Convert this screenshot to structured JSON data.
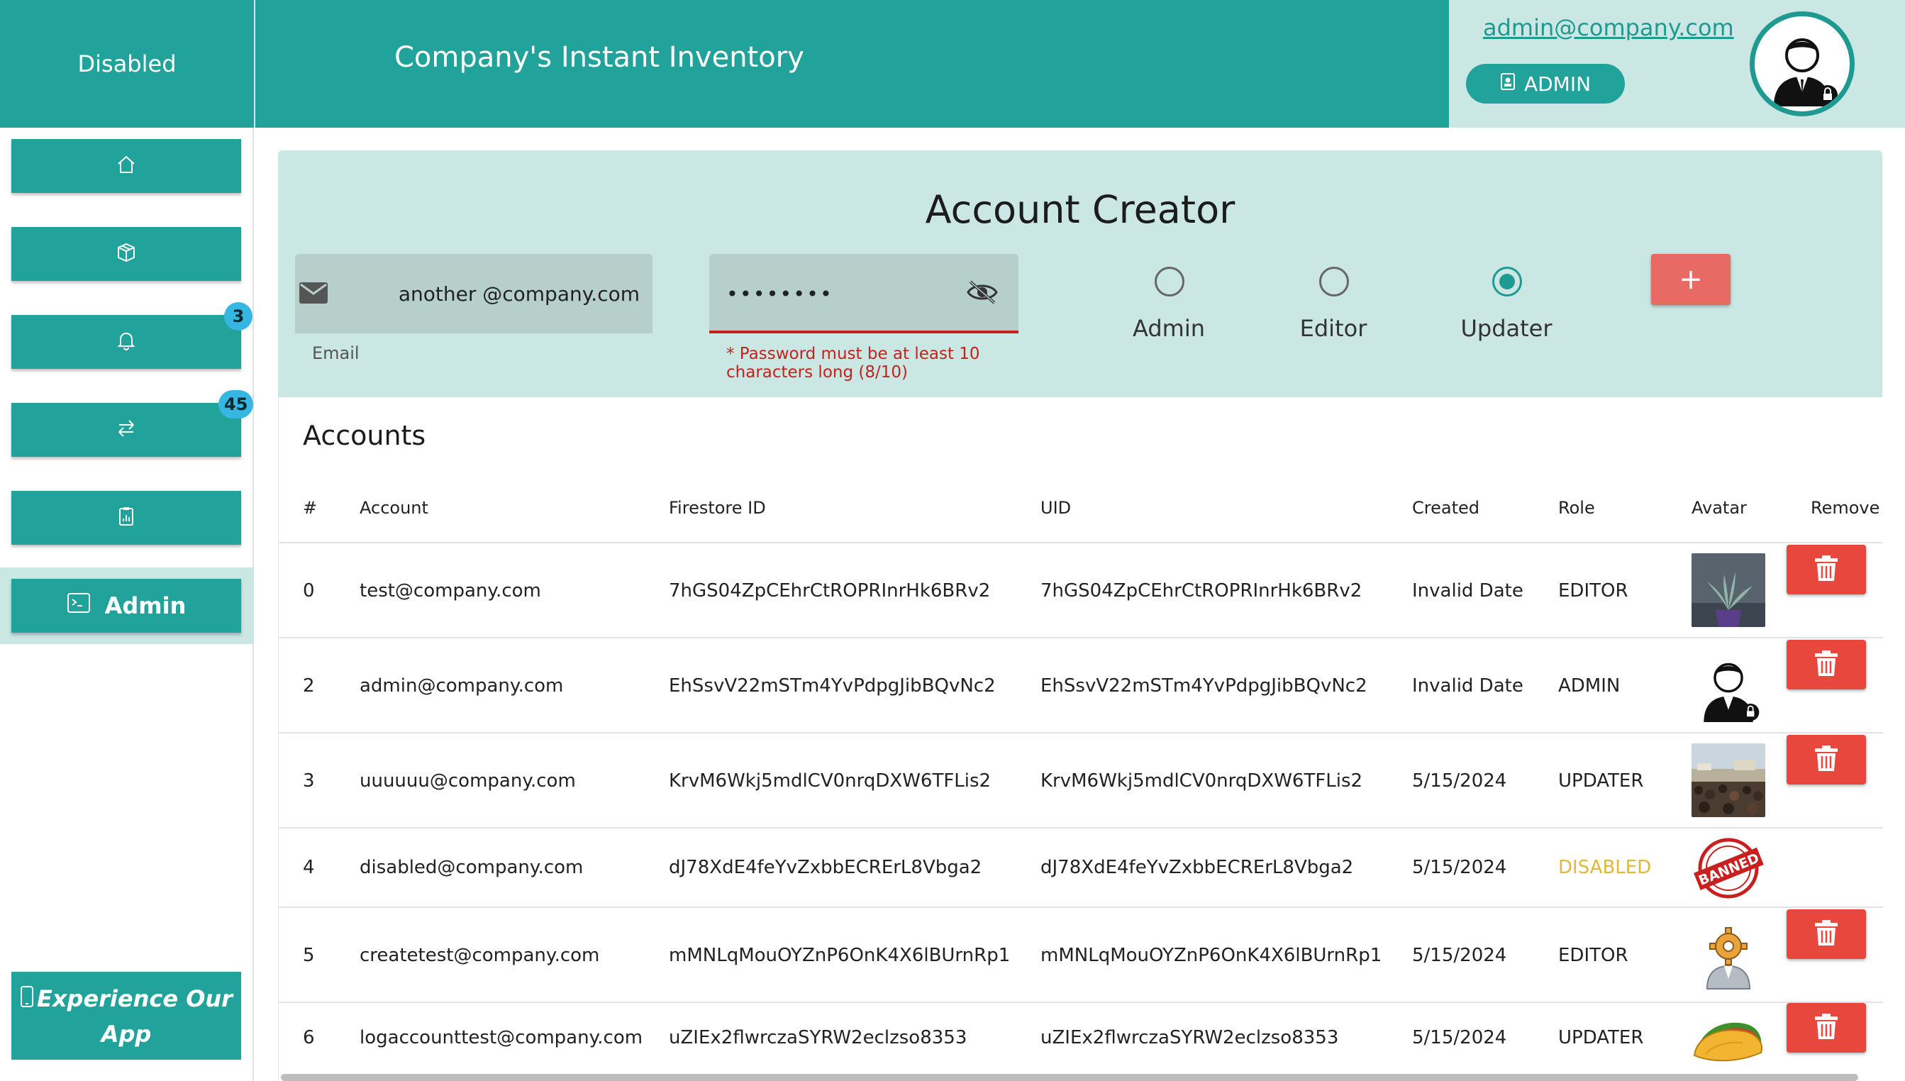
{
  "header": {
    "status": "Disabled",
    "title": "Company's Instant Inventory",
    "user_email": "admin@company.com",
    "role_badge": "ADMIN"
  },
  "sidebar": {
    "items": [
      {
        "icon": "home-icon"
      },
      {
        "icon": "box-icon"
      },
      {
        "icon": "bell-icon",
        "badge": "3"
      },
      {
        "icon": "transfer-icon",
        "badge": "45"
      },
      {
        "icon": "report-icon"
      }
    ],
    "admin_label": "Admin",
    "app_button_line1": "Experience Our",
    "app_button_line2": "App"
  },
  "creator": {
    "title": "Account Creator",
    "email_value": "another @company.com",
    "email_label": "Email",
    "password_value": "••••••••",
    "password_error": "* Password must be at least 10 characters long (8/10)",
    "roles": [
      "Admin",
      "Editor",
      "Updater"
    ],
    "selected_role": "Updater",
    "add_label": "+"
  },
  "accounts": {
    "title": "Accounts",
    "columns": [
      "#",
      "Account",
      "Firestore ID",
      "UID",
      "Created",
      "Role",
      "Avatar",
      "Remove"
    ],
    "rows": [
      {
        "num": "0",
        "account": "test@company.com",
        "firestore_id": "7hGS04ZpCEhrCtROPRInrHk6BRv2",
        "uid": "7hGS04ZpCEhrCtROPRInrHk6BRv2",
        "created": "Invalid Date",
        "role": "EDITOR",
        "avatar": "plant-photo"
      },
      {
        "num": "2",
        "account": "admin@company.com",
        "firestore_id": "EhSsvV22mSTm4YvPdpgJibBQvNc2",
        "uid": "EhSsvV22mSTm4YvPdpgJibBQvNc2",
        "created": "Invalid Date",
        "role": "ADMIN",
        "avatar": "admin-user-icon"
      },
      {
        "num": "3",
        "account": "uuuuuu@company.com",
        "firestore_id": "KrvM6Wkj5mdlCV0nrqDXW6TFLis2",
        "uid": "KrvM6Wkj5mdlCV0nrqDXW6TFLis2",
        "created": "5/15/2024",
        "role": "UPDATER",
        "avatar": "crowd-photo"
      },
      {
        "num": "4",
        "account": "disabled@company.com",
        "firestore_id": "dJ78XdE4feYvZxbbECRErL8Vbga2",
        "uid": "dJ78XdE4feYvZxbbECRErL8Vbga2",
        "created": "5/15/2024",
        "role": "DISABLED",
        "avatar": "banned-stamp",
        "stamp_text": "BANNED"
      },
      {
        "num": "5",
        "account": "createtest@company.com",
        "firestore_id": "mMNLqMouOYZnP6OnK4X6lBUrnRp1",
        "uid": "mMNLqMouOYZnP6OnK4X6lBUrnRp1",
        "created": "5/15/2024",
        "role": "EDITOR",
        "avatar": "gear-user-icon"
      },
      {
        "num": "6",
        "account": "logaccounttest@company.com",
        "firestore_id": "uZIEx2flwrczaSYRW2eclzso8353",
        "uid": "uZIEx2flwrczaSYRW2eclzso8353",
        "created": "5/15/2024",
        "role": "UPDATER",
        "avatar": "taco-icon"
      }
    ]
  },
  "colors": {
    "primary": "#21a39b",
    "light": "#cbe7e3",
    "error": "#c3221f",
    "delete": "#e8473e",
    "disabled_role": "#e0b93a",
    "badge": "#35b7e2"
  }
}
